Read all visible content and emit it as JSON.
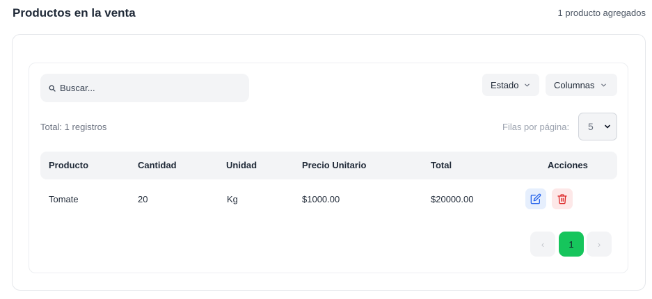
{
  "header": {
    "title": "Productos en la venta",
    "count_text": "1 producto agregados"
  },
  "toolbar": {
    "search_placeholder": "Buscar...",
    "estado_label": "Estado",
    "columnas_label": "Columnas"
  },
  "summary": {
    "total_text": "Total: 1 registros",
    "rows_per_page_label": "Filas por página:",
    "rows_per_page_value": "5"
  },
  "table": {
    "columns": [
      "Producto",
      "Cantidad",
      "Unidad",
      "Precio Unitario",
      "Total",
      "Acciones"
    ],
    "rows": [
      {
        "producto": "Tomate",
        "cantidad": "20",
        "unidad": "Kg",
        "precio_unitario": "$1000.00",
        "total": "$20000.00"
      }
    ]
  },
  "pagination": {
    "prev": "‹",
    "current": "1",
    "next": "›"
  },
  "colors": {
    "accent_green": "#16c55c",
    "edit_blue": "#2563eb",
    "delete_red": "#dc2626"
  },
  "icons": {
    "search": "search-icon",
    "chevron": "chevron-down-icon",
    "edit": "edit-icon",
    "delete": "trash-icon"
  }
}
